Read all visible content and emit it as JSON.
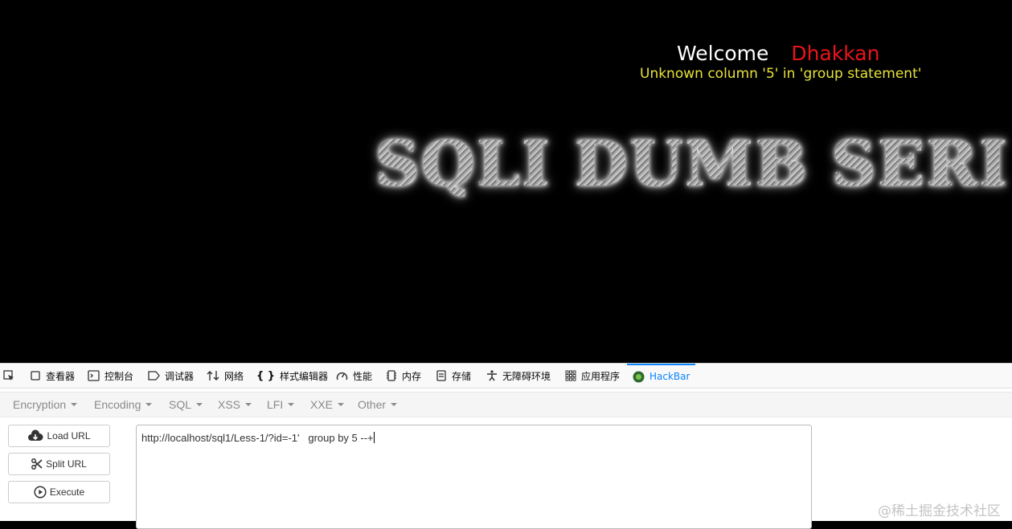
{
  "page": {
    "welcome_label": "Welcome",
    "username": "Dhakkan",
    "error_message": "Unknown column '5' in 'group statement'",
    "banner_text": "SQLI DUMB SERI"
  },
  "devtools": {
    "tabs": [
      {
        "label": "查看器",
        "icon": "inspector-icon"
      },
      {
        "label": "控制台",
        "icon": "console-icon"
      },
      {
        "label": "调试器",
        "icon": "debugger-icon"
      },
      {
        "label": "网络",
        "icon": "network-icon"
      },
      {
        "label": "样式编辑器",
        "icon": "style-editor-icon"
      },
      {
        "label": "性能",
        "icon": "performance-icon"
      },
      {
        "label": "内存",
        "icon": "memory-icon"
      },
      {
        "label": "存储",
        "icon": "storage-icon"
      },
      {
        "label": "无障碍环境",
        "icon": "accessibility-icon"
      },
      {
        "label": "应用程序",
        "icon": "application-icon"
      },
      {
        "label": "HackBar",
        "icon": "hackbar-icon"
      }
    ],
    "active_tab": "HackBar"
  },
  "hackbar": {
    "menus": [
      "Encryption",
      "Encoding",
      "SQL",
      "XSS",
      "LFI",
      "XXE",
      "Other"
    ],
    "buttons": {
      "load": "Load URL",
      "split": "Split URL",
      "execute": "Execute"
    },
    "url_value": "http://localhost/sql1/Less-1/?id=-1'   group by 5 --+"
  },
  "watermark": "@稀土掘金技术社区",
  "colors": {
    "username": "#e8141c",
    "error": "#e8e23a",
    "active_tab": "#0a84ff"
  }
}
